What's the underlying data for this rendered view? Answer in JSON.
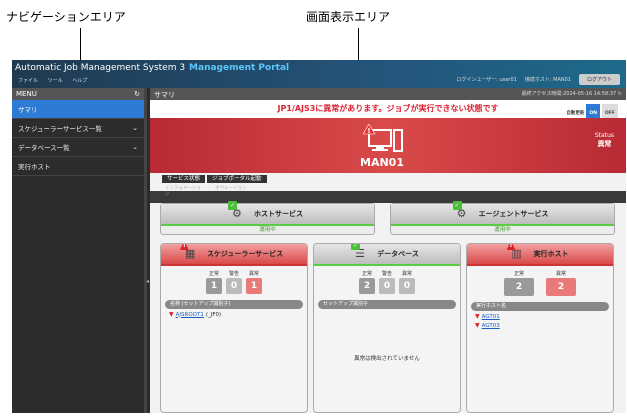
{
  "callouts": {
    "nav": "ナビゲーションエリア",
    "screen": "画面表示エリア"
  },
  "header": {
    "app_title": "Automatic Job Management System 3",
    "portal": "Management Portal",
    "menu": [
      "ファイル",
      "ツール",
      "ヘルプ"
    ],
    "login_user": "ログインユーザー: user01",
    "connected_host": "接続ホスト: MAN01",
    "logout": "ログアウト"
  },
  "sidebar": {
    "title": "MENU",
    "items": [
      {
        "label": "サマリ"
      },
      {
        "label": "スケジューラーサービス一覧"
      },
      {
        "label": "データベース一覧"
      },
      {
        "label": "実行ホスト"
      }
    ]
  },
  "main": {
    "title": "サマリ",
    "last_access": "最終アクセス時間:2024-05-16 14:58:37",
    "alert": "JP1/AJS3に異常があります。ジョブが実行できない状態です",
    "auto_update": "自動更新",
    "on": "ON",
    "off": "OFF",
    "host": "MAN01",
    "status_label": "Status",
    "status_value": "異常",
    "tabs": [
      {
        "label": "サービス状態",
        "sub": "インフォメーション"
      },
      {
        "label": "ジョブポータル起動",
        "sub": "オペレーション"
      }
    ]
  },
  "services": {
    "host_service": {
      "title": "ホストサービス",
      "state": "運用中"
    },
    "agent_service": {
      "title": "エージェントサービス",
      "state": "運用中"
    }
  },
  "panels": {
    "scheduler": {
      "title": "スケジューラーサービス",
      "counts": [
        {
          "label": "正常",
          "value": "1"
        },
        {
          "label": "警告",
          "value": "0"
        },
        {
          "label": "異常",
          "value": "1"
        }
      ],
      "list_header": "名称 (セットアップ識別子)",
      "rows": [
        {
          "link": "AJSROOT1",
          "suffix": "(_JF0)"
        }
      ]
    },
    "database": {
      "title": "データベース",
      "counts": [
        {
          "label": "正常",
          "value": "2"
        },
        {
          "label": "警告",
          "value": "0"
        },
        {
          "label": "異常",
          "value": "0"
        }
      ],
      "list_header": "セットアップ識別子",
      "empty": "異常は検出されていません"
    },
    "exec_host": {
      "title": "実行ホスト",
      "counts": [
        {
          "label": "正常",
          "value": "2"
        },
        {
          "label": "異常",
          "value": "2"
        }
      ],
      "list_header": "実行ホスト名",
      "rows": [
        {
          "link": "AGT01"
        },
        {
          "link": "AGT03"
        }
      ]
    }
  },
  "colors": {
    "accent": "#2d7bd4",
    "error": "#d94a4a",
    "ok": "#5bcb43"
  }
}
